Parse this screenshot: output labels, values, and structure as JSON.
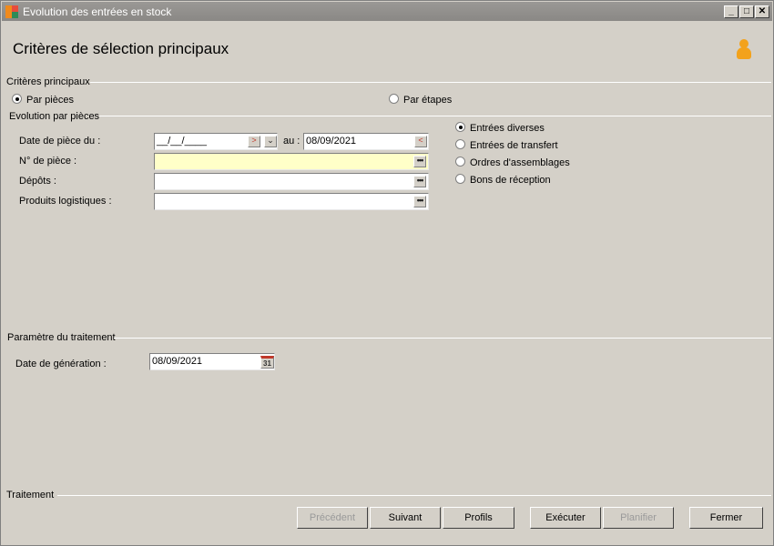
{
  "window": {
    "title": "Evolution des entrées en stock"
  },
  "header": {
    "title": "Critères de sélection principaux"
  },
  "criteres": {
    "section_label": "Critères principaux",
    "option_pieces": "Par pièces",
    "option_etapes": "Par étapes",
    "selected": "Par pièces"
  },
  "evolution": {
    "section_label": "Evolution par pièces",
    "date_label": "Date de pièce du :",
    "date_from": "__/__/____",
    "au_label": "au :",
    "date_to": "08/09/2021",
    "num_piece_label": "N° de pièce  :",
    "num_piece_value": "",
    "depots_label": "Dépôts :",
    "depots_value": "",
    "produits_label": "Produits logistiques :",
    "produits_value": "",
    "types": [
      "Entrées diverses",
      "Entrées de transfert",
      "Ordres d'assemblages",
      "Bons de réception"
    ],
    "selected_type": "Entrées diverses"
  },
  "parametre": {
    "section_label": "Paramètre du traitement",
    "date_gen_label": "Date de génération :",
    "date_gen_value": "08/09/2021",
    "calendar_day": "31"
  },
  "footer": {
    "section_label": "Traitement",
    "buttons": {
      "precedent": "Précédent",
      "suivant": "Suivant",
      "profils": "Profils",
      "executer": "Exécuter",
      "planifier": "Planifier",
      "fermer": "Fermer"
    }
  },
  "colors": {
    "input_highlight": "#ffffc8",
    "user_icon": "#f3a21b",
    "titlebar": "#8a8885"
  },
  "icons": {
    "app": "app-logo-icon",
    "user": "user-icon",
    "calendar": "calendar-icon",
    "ellipsis": "ellipsis-icon"
  }
}
